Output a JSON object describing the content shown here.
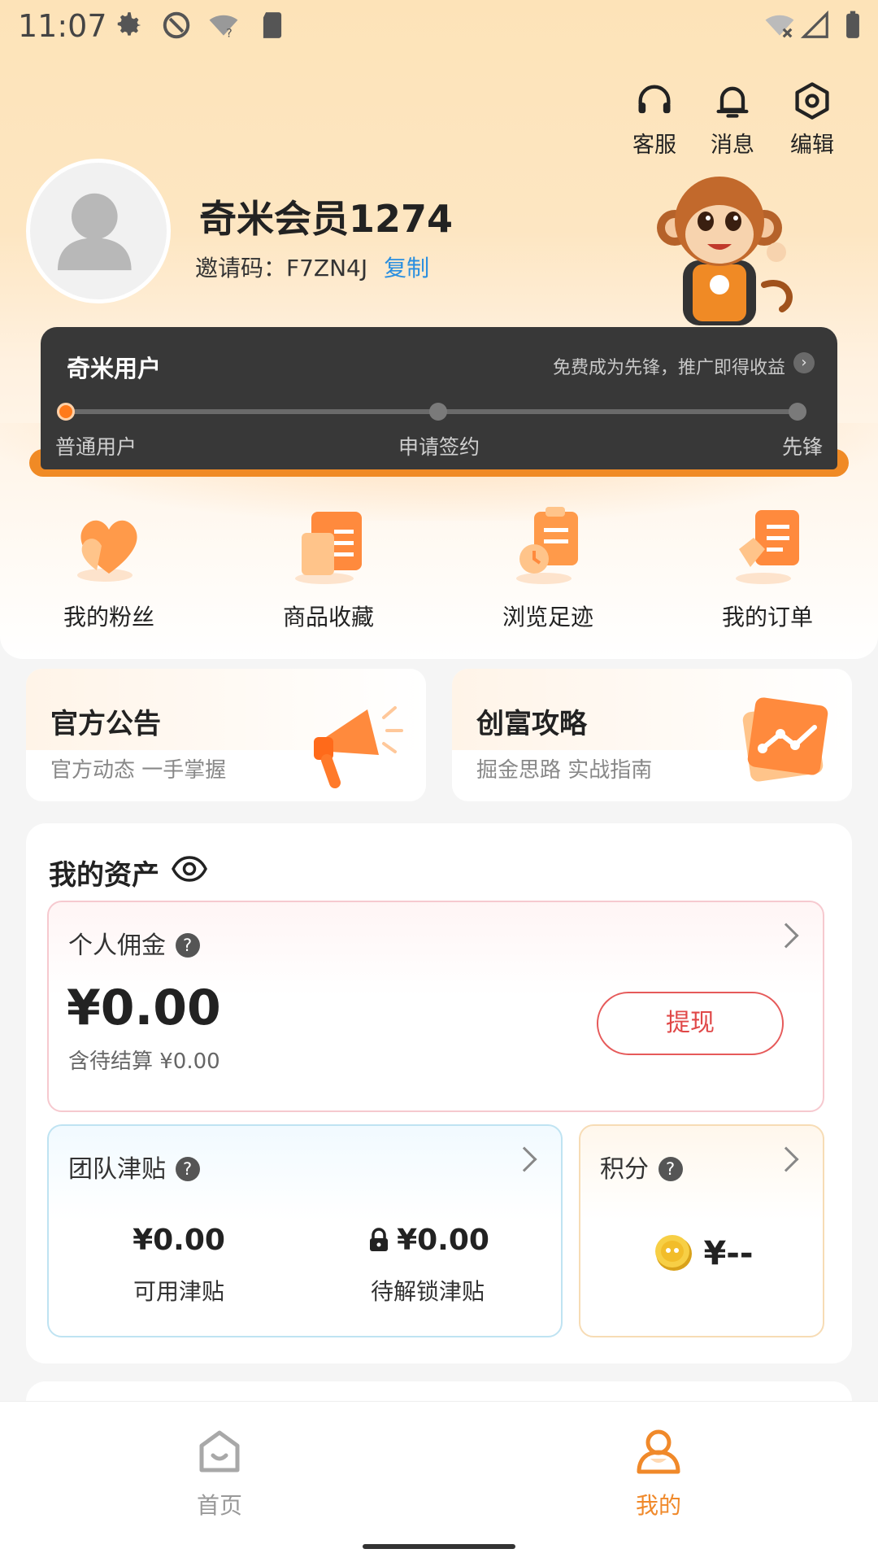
{
  "status_bar": {
    "time": "11:07"
  },
  "top_actions": [
    {
      "label": "客服",
      "icon": "headset-icon"
    },
    {
      "label": "消息",
      "icon": "bell-icon"
    },
    {
      "label": "编辑",
      "icon": "settings-hex-icon"
    }
  ],
  "profile": {
    "username": "奇米会员1274",
    "invite_label": "邀请码：F7ZN4J",
    "copy_label": "复制"
  },
  "level": {
    "title": "奇米用户",
    "promo": "免费成为先锋，推广即得收益",
    "steps": [
      "普通用户",
      "申请签约",
      "先锋"
    ],
    "current_step_index": 0
  },
  "quick_tiles": [
    {
      "label": "我的粉丝",
      "icon": "heart-icon"
    },
    {
      "label": "商品收藏",
      "icon": "collection-icon"
    },
    {
      "label": "浏览足迹",
      "icon": "history-icon"
    },
    {
      "label": "我的订单",
      "icon": "order-icon"
    }
  ],
  "promo_cards": [
    {
      "title": "官方公告",
      "subtitle": "官方动态 一手掌握",
      "icon": "megaphone-icon"
    },
    {
      "title": "创富攻略",
      "subtitle": "掘金思路 实战指南",
      "icon": "chart-card-icon"
    }
  ],
  "assets": {
    "title": "我的资产",
    "commission": {
      "label": "个人佣金",
      "amount": "¥0.00",
      "pending": "含待结算 ¥0.00",
      "withdraw_label": "提现"
    },
    "team": {
      "label": "团队津贴",
      "available_value": "¥0.00",
      "available_label": "可用津贴",
      "locked_value": "¥0.00",
      "locked_label": "待解锁津贴"
    },
    "points": {
      "label": "积分",
      "value": "¥--"
    }
  },
  "bottom_nav": [
    {
      "label": "首页",
      "icon": "home-icon",
      "active": false
    },
    {
      "label": "我的",
      "icon": "profile-icon",
      "active": true
    }
  ],
  "colors": {
    "accent": "#f08a25",
    "active_nav": "#f0892a",
    "inactive_nav": "#999999",
    "link": "#2a8fe0",
    "withdraw": "#e04848"
  }
}
